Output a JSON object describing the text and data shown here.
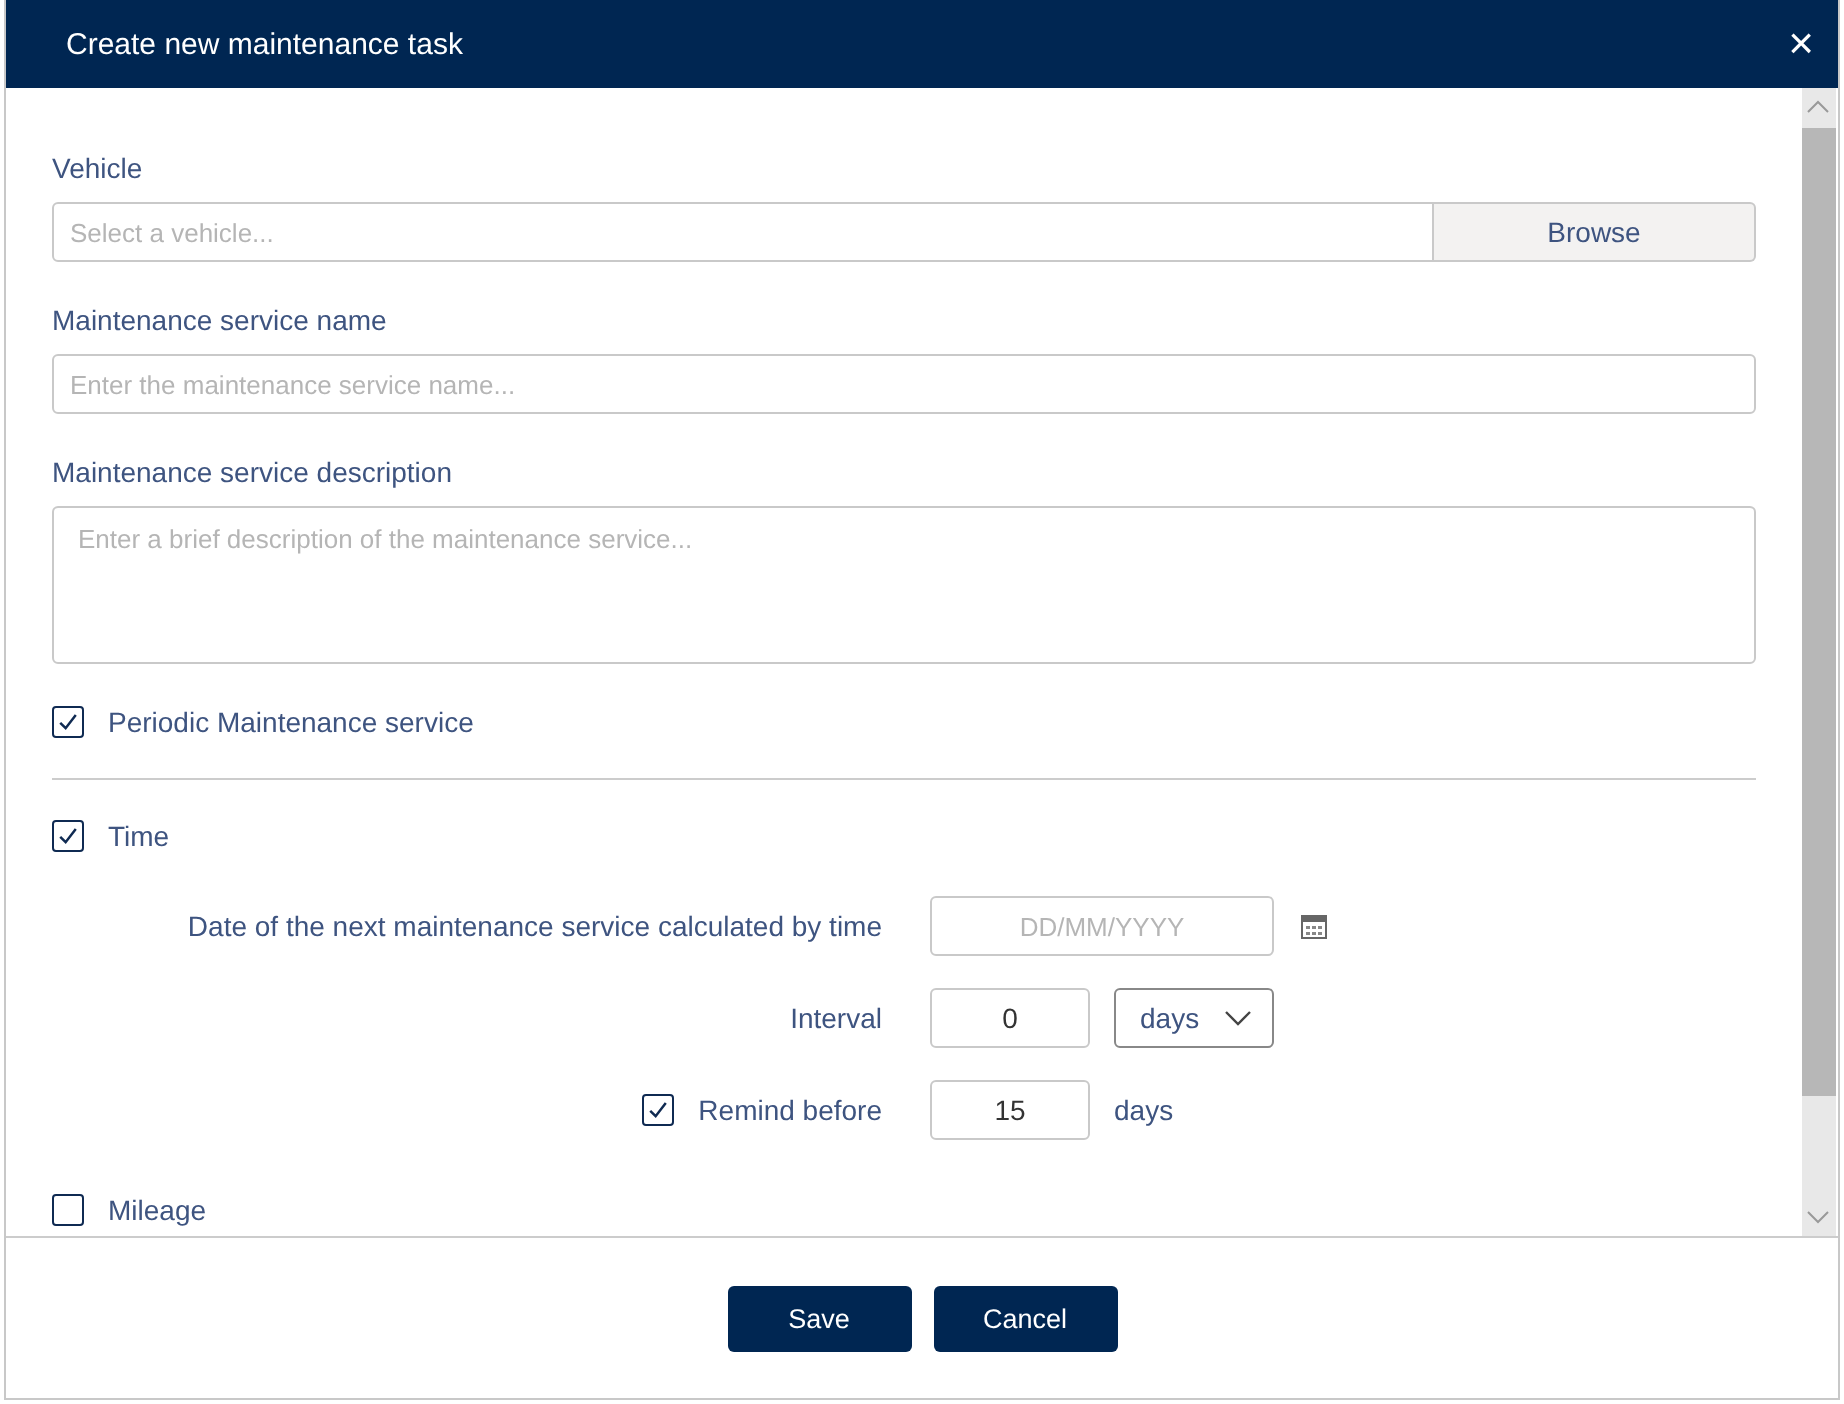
{
  "dialog": {
    "title": "Create new maintenance task",
    "close": "×"
  },
  "vehicle": {
    "label": "Vehicle",
    "placeholder": "Select a vehicle...",
    "button": "Browse"
  },
  "service_name": {
    "label": "Maintenance service name",
    "placeholder": "Enter the maintenance service name..."
  },
  "service_description": {
    "label": "Maintenance service description",
    "placeholder": "Enter a brief description of the maintenance service..."
  },
  "periodic": {
    "label": "Periodic Maintenance service",
    "checked": true
  },
  "time": {
    "label": "Time",
    "checked": true,
    "next_date": {
      "label": "Date of the next maintenance service calculated by time",
      "placeholder": "DD/MM/YYYY"
    },
    "interval": {
      "label": "Interval",
      "value": "0",
      "unit": "days"
    },
    "remind": {
      "label": "Remind before",
      "checked": true,
      "value": "15",
      "unit": "days"
    }
  },
  "mileage": {
    "label": "Mileage",
    "checked": false
  },
  "buttons": [
    "Save",
    "Cancel"
  ]
}
